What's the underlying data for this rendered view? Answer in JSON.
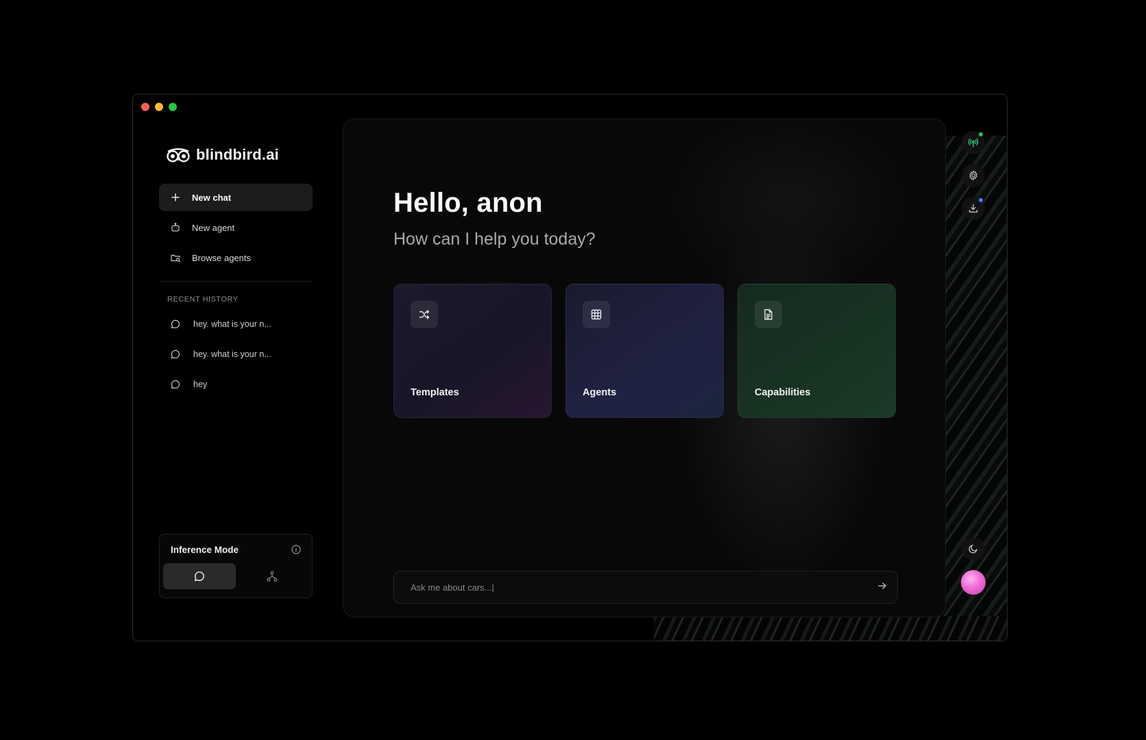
{
  "brand": {
    "name": "blindbird.ai"
  },
  "nav": [
    {
      "label": "New chat",
      "icon": "plus-icon",
      "active": true
    },
    {
      "label": "New agent",
      "icon": "robot-icon",
      "active": false
    },
    {
      "label": "Browse agents",
      "icon": "folder-search-icon",
      "active": false
    }
  ],
  "history": {
    "label": "RECENT HISTORY",
    "items": [
      {
        "label": "hey. what is your n..."
      },
      {
        "label": "hey. what is your n..."
      },
      {
        "label": "hey"
      }
    ]
  },
  "inference": {
    "title": "Inference Mode",
    "modes": [
      {
        "icon": "chat-bubble-icon",
        "active": true
      },
      {
        "icon": "network-icon",
        "active": false
      }
    ]
  },
  "main": {
    "greeting": "Hello, anon",
    "subtitle": "How can I help you today?",
    "cards": [
      {
        "label": "Templates",
        "icon": "shuffle-icon"
      },
      {
        "label": "Agents",
        "icon": "grid-icon"
      },
      {
        "label": "Capabilities",
        "icon": "document-icon"
      }
    ],
    "chat": {
      "placeholder": "Ask me about cars...|"
    }
  },
  "rail": [
    {
      "icon": "broadcast-icon",
      "status_color": "#22c55e"
    },
    {
      "icon": "gear-icon"
    },
    {
      "icon": "download-icon",
      "status_color": "#3b82f6"
    },
    {
      "icon": "moon-icon"
    },
    {
      "icon": "avatar-orb"
    }
  ],
  "colors": {
    "accent_pink": "#f06ad8",
    "status_green": "#22c55e",
    "status_blue": "#3b82f6"
  }
}
